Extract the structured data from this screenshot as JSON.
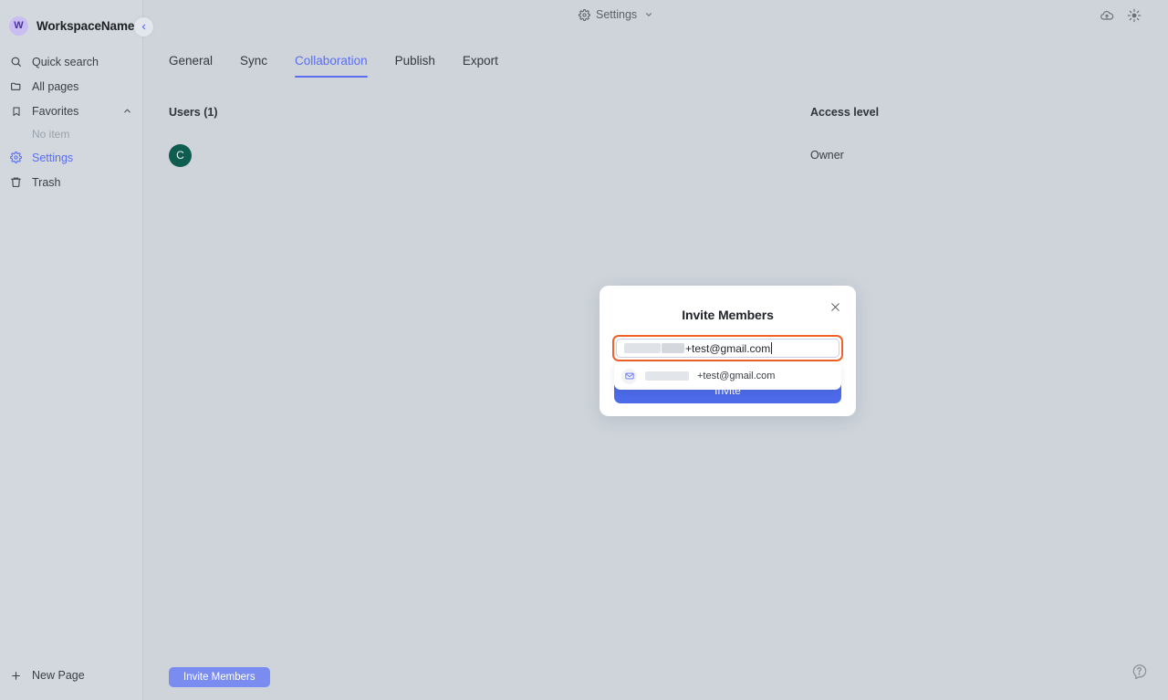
{
  "sidebar": {
    "workspace": {
      "badge_letter": "W",
      "name": "WorkspaceName"
    },
    "collapse_label": "‹",
    "items": [
      {
        "label": "Quick search",
        "icon": "search-icon"
      },
      {
        "label": "All pages",
        "icon": "folder-icon"
      },
      {
        "label": "Favorites",
        "icon": "bookmark-icon",
        "chevron": "chevron-up-icon"
      },
      {
        "label": "Settings",
        "icon": "gear-icon"
      },
      {
        "label": "Trash",
        "icon": "trash-icon"
      }
    ],
    "favorites_empty": "No item",
    "new_page": {
      "label": "New Page",
      "icon": "plus-icon"
    }
  },
  "topbar": {
    "settings_label": "Settings",
    "gear_icon": "gear-icon",
    "chevron_icon": "chevron-down-icon",
    "cloud_icon": "cloud-sync-icon",
    "theme_icon": "sun-icon"
  },
  "tabs": [
    {
      "label": "General",
      "active": false
    },
    {
      "label": "Sync",
      "active": false
    },
    {
      "label": "Collaboration",
      "active": true
    },
    {
      "label": "Publish",
      "active": false
    },
    {
      "label": "Export",
      "active": false
    }
  ],
  "table": {
    "header_users": "Users (1)",
    "header_access": "Access level",
    "rows": [
      {
        "avatar_letter": "C",
        "access": "Owner"
      }
    ]
  },
  "actions": {
    "invite_members": "Invite Members",
    "help_icon": "help-icon"
  },
  "modal": {
    "title": "Invite Members",
    "close_icon": "close-icon",
    "input": {
      "value_visible": "+test@gmail.com",
      "redacted": true
    },
    "suggestion": {
      "icon": "envelope-icon",
      "text": "+test@gmail.com"
    },
    "submit_label": "Invite"
  },
  "colors": {
    "background": "#ced4da",
    "sidebar": "#d2d8dd",
    "accent_blue": "#5b6ef2",
    "submit_blue": "#4d6ae8",
    "avatar_green": "#0f5c50",
    "focus_orange": "#f0622a",
    "badge_purple": "#c9bdf2"
  }
}
